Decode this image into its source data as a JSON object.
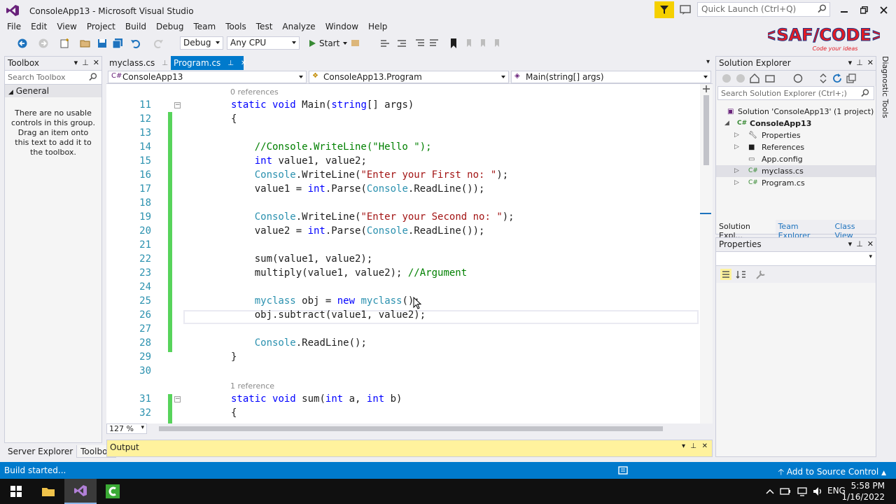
{
  "window": {
    "title": "ConsoleApp13 - Microsoft Visual Studio",
    "quick_launch_placeholder": "Quick Launch (Ctrl+Q)"
  },
  "menu": [
    "File",
    "Edit",
    "View",
    "Project",
    "Build",
    "Debug",
    "Team",
    "Tools",
    "Test",
    "Analyze",
    "Window",
    "Help"
  ],
  "toolbar": {
    "config": "Debug",
    "platform": "Any CPU",
    "start_label": "Start"
  },
  "logo": {
    "brand": "<SAF/CODE>",
    "tagline": "Code your ideas"
  },
  "toolbox": {
    "title": "Toolbox",
    "search_placeholder": "Search Toolbox",
    "group": "General",
    "empty_message": "There are no usable controls in this group. Drag an item onto this text to add it to the toolbox."
  },
  "bottom_left_tabs": [
    "Server Explorer",
    "Toolbox"
  ],
  "doc_tabs": [
    "myclass.cs",
    "Program.cs"
  ],
  "nav": {
    "project": "ConsoleApp13",
    "class": "ConsoleApp13.Program",
    "member": "Main(string[] args)"
  },
  "code": {
    "codelens_main": "0 references",
    "codelens_sum": "1 reference",
    "lines": [
      {
        "n": "11",
        "t": "static void Main(string[] args)"
      },
      {
        "n": "12",
        "t": "{"
      },
      {
        "n": "13",
        "t": ""
      },
      {
        "n": "14",
        "t": "    //Console.WriteLine(\"Hello \");"
      },
      {
        "n": "15",
        "t": "    int value1, value2;"
      },
      {
        "n": "16",
        "t": "    Console.WriteLine(\"Enter your First no: \");"
      },
      {
        "n": "17",
        "t": "    value1 = int.Parse(Console.ReadLine());"
      },
      {
        "n": "18",
        "t": ""
      },
      {
        "n": "19",
        "t": "    Console.WriteLine(\"Enter your Second no: \");"
      },
      {
        "n": "20",
        "t": "    value2 = int.Parse(Console.ReadLine());"
      },
      {
        "n": "21",
        "t": ""
      },
      {
        "n": "22",
        "t": "    sum(value1, value2);"
      },
      {
        "n": "23",
        "t": "    multiply(value1, value2); //Argument"
      },
      {
        "n": "24",
        "t": ""
      },
      {
        "n": "25",
        "t": "    myclass obj = new myclass();"
      },
      {
        "n": "26",
        "t": "    obj.subtract(value1, value2);"
      },
      {
        "n": "27",
        "t": ""
      },
      {
        "n": "28",
        "t": "    Console.ReadLine();"
      },
      {
        "n": "29",
        "t": "}"
      },
      {
        "n": "30",
        "t": ""
      },
      {
        "n": "31",
        "t": "static void sum(int a, int b)"
      },
      {
        "n": "32",
        "t": "{"
      }
    ]
  },
  "zoom": "127 %",
  "output": {
    "title": "Output"
  },
  "solution_explorer": {
    "title": "Solution Explorer",
    "search_placeholder": "Search Solution Explorer (Ctrl+;)",
    "solution": "Solution 'ConsoleApp13' (1 project)",
    "project": "ConsoleApp13",
    "items": [
      "Properties",
      "References",
      "App.config",
      "myclass.cs",
      "Program.cs"
    ],
    "tabs": [
      "Solution Expl...",
      "Team Explorer",
      "Class View"
    ]
  },
  "properties": {
    "title": "Properties"
  },
  "diagnostic_tools": "Diagnostic Tools",
  "status": {
    "text": "Build started...",
    "source_control": "Add to Source Control"
  },
  "taskbar": {
    "lang": "ENG",
    "time": "5:58 PM",
    "date": "1/16/2022"
  }
}
